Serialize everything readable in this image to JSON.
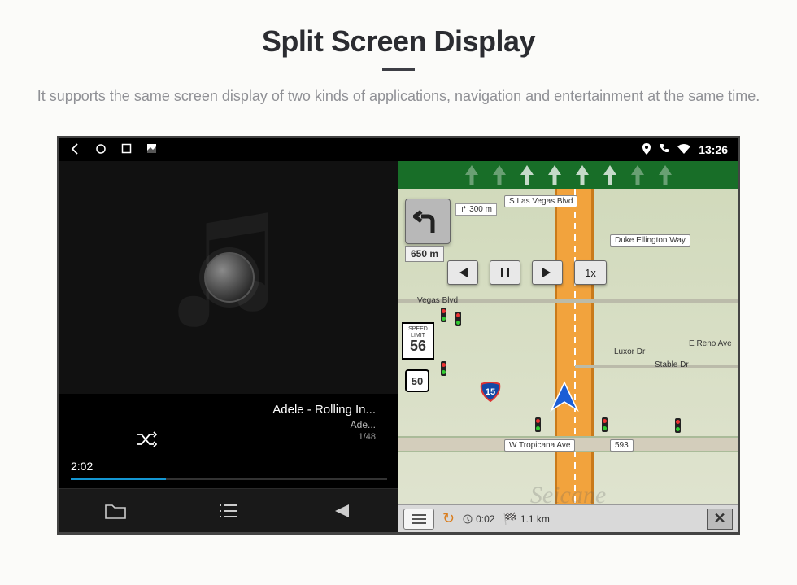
{
  "page": {
    "title": "Split Screen Display",
    "subtitle": "It supports the same screen display of two kinds of applications, navigation and entertainment at the same time."
  },
  "status": {
    "time": "13:26"
  },
  "music": {
    "track_title": "Adele - Rolling In...",
    "track_artist": "Ade...",
    "track_count": "1/48",
    "elapsed": "2:02"
  },
  "nav": {
    "street_top": "S Las Vegas Blvd",
    "turn_dist_short": "300 m",
    "turn_dist_main": "650 m",
    "street_duke": "Duke Ellington Way",
    "street_vegas": "Vegas Blvd",
    "street_luxor": "Luxor Dr",
    "street_reno": "E Reno Ave",
    "street_stable": "Stable Dr",
    "street_bottom": "W Tropicana Ave",
    "street_num": "593",
    "speed_limit_label1": "SPEED",
    "speed_limit_label2": "LIMIT",
    "speed_limit_value": "56",
    "route_number": "50",
    "playback_speed": "1x",
    "eta_time": "0:02",
    "remaining_dist": "1.1 km",
    "interstate": "15"
  },
  "watermark": "Seicane"
}
